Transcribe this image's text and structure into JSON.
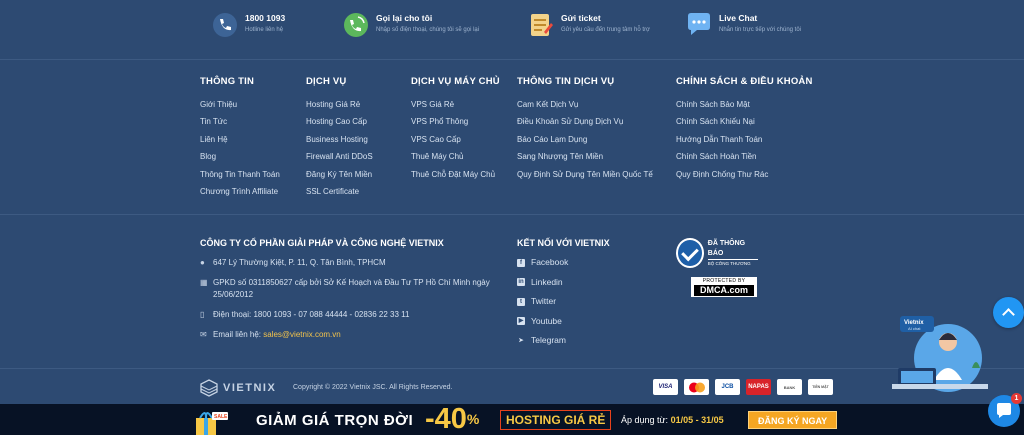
{
  "contacts": [
    {
      "title": "1800 1093",
      "sub": "Hotline liên hệ"
    },
    {
      "title": "Gọi lại cho tôi",
      "sub": "Nhập số điện thoại, chúng tôi sẽ gọi lại"
    },
    {
      "title": "Gửi ticket",
      "sub": "Gửi yêu cầu đến trung tâm hỗ trợ"
    },
    {
      "title": "Live Chat",
      "sub": "Nhắn tin trực tiếp với chúng tôi"
    }
  ],
  "columns": [
    {
      "heading": "THÔNG TIN",
      "links": [
        "Giới Thiệu",
        "Tin Tức",
        "Liên Hệ",
        "Blog",
        "Thông Tin Thanh Toán",
        "Chương Trình Affiliate"
      ]
    },
    {
      "heading": "DỊCH VỤ",
      "links": [
        "Hosting Giá Rẻ",
        "Hosting Cao Cấp",
        "Business Hosting",
        "Firewall Anti DDoS",
        "Đăng Ký Tên Miền",
        "SSL Certificate"
      ]
    },
    {
      "heading": "DỊCH VỤ MÁY CHỦ",
      "links": [
        "VPS Giá Rẻ",
        "VPS Phổ Thông",
        "VPS Cao Cấp",
        "Thuê Máy Chủ",
        "Thuê Chỗ Đặt Máy Chủ"
      ]
    },
    {
      "heading": "THÔNG TIN DỊCH VỤ",
      "links": [
        "Cam Kết Dịch Vụ",
        "Điều Khoản Sử Dụng Dịch Vụ",
        "Báo Cáo Lạm Dụng",
        "Sang Nhượng Tên Miền",
        "Quy Định Sử Dụng Tên Miền Quốc Tế"
      ]
    },
    {
      "heading": "CHÍNH SÁCH & ĐIỀU KHOẢN",
      "links": [
        "Chính Sách Bảo Mật",
        "Chính Sách Khiếu Nại",
        "Hướng Dẫn Thanh Toán",
        "Chính Sách Hoàn Tiền",
        "Quy Định Chống Thư Rác"
      ]
    }
  ],
  "company": {
    "heading": "CÔNG TY CỔ PHẦN GIẢI PHÁP VÀ CÔNG NGHỆ VIETNIX",
    "address": "647 Lý Thường Kiệt, P. 11, Q. Tân Bình, TPHCM",
    "license": "GPKD số 0311850627 cấp bởi Sở Kế Hoạch và Đầu Tư TP Hồ Chí Minh ngày 25/06/2012",
    "phone": "Điện thoại: 1800 1093 - 07 088 44444 - 02836 22 33 11",
    "email_label": "Email liên hệ: ",
    "email": "sales@vietnix.com.vn"
  },
  "social": {
    "heading": "KẾT NỐI VỚI VIETNIX",
    "links": [
      "Facebook",
      "Linkedin",
      "Twitter",
      "Youtube",
      "Telegram"
    ]
  },
  "badges": {
    "bct_line1": "ĐÃ THÔNG BÁO",
    "bct_line2": "BỘ CÔNG THƯƠNG",
    "dmca_line1": "PROTECTED BY",
    "dmca_line2": "DMCA.com"
  },
  "bottom": {
    "logo": "VIETNIX",
    "copyright": "Copyright © 2022 Vietnix JSC. All Rights Reserved.",
    "payments": [
      "VISA",
      "MC",
      "JCB",
      "NAPAS",
      "BANK",
      "TIỀN MẶT"
    ]
  },
  "banner": {
    "headline": "GIẢM GIÁ TRỌN ĐỜI",
    "discount": "-40",
    "percent": "%",
    "product": "HOSTING GIÁ RẺ",
    "apply_label": "Áp dụng từ: ",
    "apply_dates": "01/05 - 31/05",
    "cta": "ĐĂNG KÝ NGAY"
  },
  "chat": {
    "badge_count": "1",
    "assistant_label": "Vietnix",
    "assistant_sub": "AI chat"
  },
  "colors": {
    "background": "#2d4a72",
    "accent": "#f7c845",
    "banner": "#071225",
    "link_email": "#f2c34c"
  }
}
